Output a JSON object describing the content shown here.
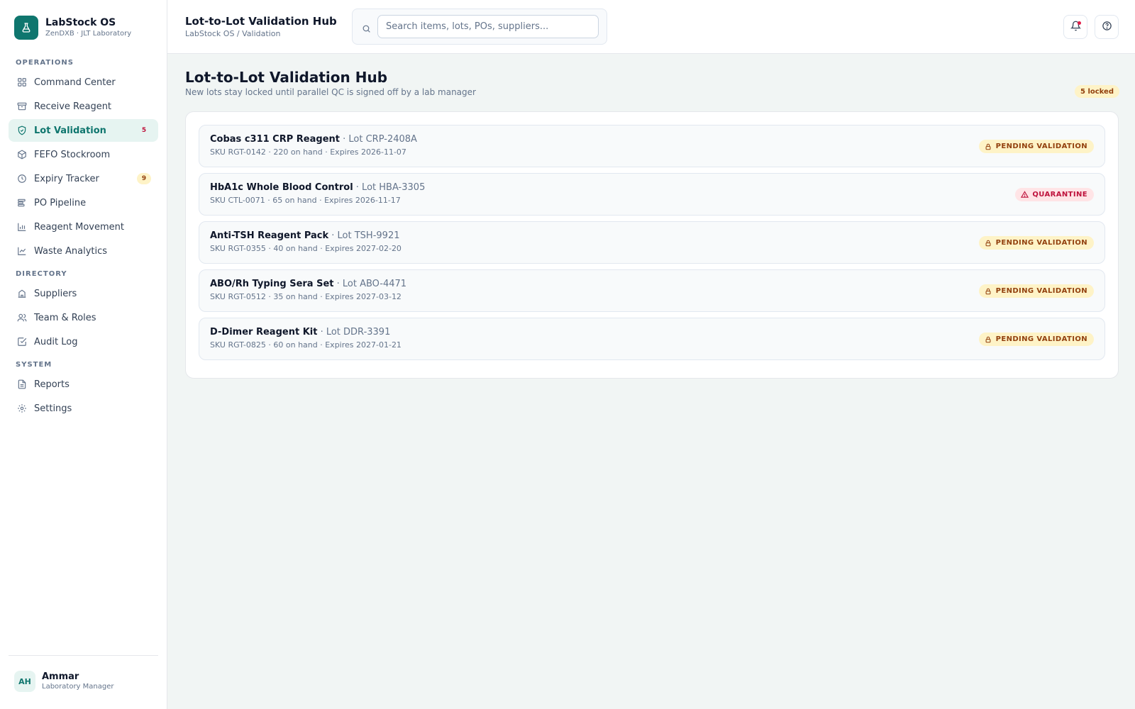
{
  "brand": {
    "name": "LabStock OS",
    "subtitle": "ZenDXB · JLT Laboratory",
    "icon": "flask-icon"
  },
  "sidebar": {
    "sections": [
      {
        "label": "OPERATIONS"
      },
      {
        "label": "DIRECTORY"
      },
      {
        "label": "SYSTEM"
      }
    ],
    "items": [
      {
        "label": "Command Center",
        "icon": "grid-icon"
      },
      {
        "label": "Receive Reagent",
        "icon": "archive-box-icon"
      },
      {
        "label": "Lot Validation",
        "icon": "shield-check-icon",
        "badge": "5",
        "active": true
      },
      {
        "label": "FEFO Stockroom",
        "icon": "package-icon"
      },
      {
        "label": "Expiry Tracker",
        "icon": "clock-icon",
        "badge": "9"
      },
      {
        "label": "PO Pipeline",
        "icon": "pipeline-icon"
      },
      {
        "label": "Reagent Movement",
        "icon": "bar-chart-icon"
      },
      {
        "label": "Waste Analytics",
        "icon": "line-chart-icon"
      },
      {
        "label": "Suppliers",
        "icon": "building-icon"
      },
      {
        "label": "Team & Roles",
        "icon": "users-icon"
      },
      {
        "label": "Audit Log",
        "icon": "check-square-icon"
      },
      {
        "label": "Reports",
        "icon": "file-text-icon"
      },
      {
        "label": "Settings",
        "icon": "gear-icon"
      }
    ]
  },
  "user": {
    "initials": "AH",
    "name": "Ammar",
    "role": "Laboratory Manager"
  },
  "header": {
    "title": "Lot-to-Lot Validation Hub",
    "breadcrumb": "LabStock OS / Validation",
    "search_placeholder": "Search items, lots, POs, suppliers..."
  },
  "main": {
    "title": "Lot-to-Lot Validation Hub",
    "subtitle": "New lots stay locked until parallel QC is signed off by a lab manager",
    "locked_count": "5 locked",
    "lots": [
      {
        "name": "Cobas c311 CRP Reagent",
        "lot": "· Lot CRP-2408A",
        "meta": "SKU RGT-0142 · 220 on hand · Expires 2026-11-07",
        "status": "PENDING VALIDATION",
        "status_type": "pending"
      },
      {
        "name": "HbA1c Whole Blood Control",
        "lot": "· Lot HBA-3305",
        "meta": "SKU CTL-0071 · 65 on hand · Expires 2026-11-17",
        "status": "QUARANTINE",
        "status_type": "quarantine"
      },
      {
        "name": "Anti-TSH Reagent Pack",
        "lot": "· Lot TSH-9921",
        "meta": "SKU RGT-0355 · 40 on hand · Expires 2027-02-20",
        "status": "PENDING VALIDATION",
        "status_type": "pending"
      },
      {
        "name": "ABO/Rh Typing Sera Set",
        "lot": "· Lot ABO-4471",
        "meta": "SKU RGT-0512 · 35 on hand · Expires 2027-03-12",
        "status": "PENDING VALIDATION",
        "status_type": "pending"
      },
      {
        "name": "D-Dimer Reagent Kit",
        "lot": "· Lot DDR-3391",
        "meta": "SKU RGT-0825 · 60 on hand · Expires 2027-01-21",
        "status": "PENDING VALIDATION",
        "status_type": "pending"
      }
    ]
  },
  "colors": {
    "accent": "#0f766e",
    "pending": "#92400e",
    "quarantine": "#be123c"
  }
}
